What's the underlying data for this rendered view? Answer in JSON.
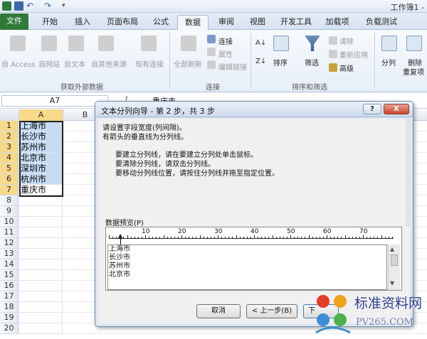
{
  "window": {
    "title": "工作簿1 -"
  },
  "tabs": {
    "file": "文件",
    "home": "开始",
    "insert": "插入",
    "layout": "页面布局",
    "formulas": "公式",
    "data": "数据",
    "review": "审阅",
    "view": "视图",
    "developer": "开发工具",
    "addins": "加载项",
    "loadtest": "负载测试"
  },
  "ribbon": {
    "from_access": "自 Access",
    "from_web": "自网站",
    "from_text": "自文本",
    "from_other": "自其他来源",
    "existing_conn": "现有连接",
    "refresh_all": "全部刷新",
    "connections": "连接",
    "properties": "属性",
    "edit_links": "编辑链接",
    "sort": "排序",
    "filter": "筛选",
    "clear": "清除",
    "reapply": "重新应用",
    "advanced": "高级",
    "text_to_columns": "分列",
    "remove_dup_1": "删除",
    "remove_dup_2": "重复项",
    "group_external": "获取外部数据",
    "group_conn": "连接",
    "group_sort": "排序和筛选"
  },
  "namebox": {
    "value": "A7"
  },
  "formula": {
    "value": "重庆市"
  },
  "columns": [
    "A",
    "B"
  ],
  "rows": [
    {
      "n": "1",
      "a": "上海市"
    },
    {
      "n": "2",
      "a": "长沙市"
    },
    {
      "n": "3",
      "a": "苏州市"
    },
    {
      "n": "4",
      "a": "北京市"
    },
    {
      "n": "5",
      "a": "深圳市"
    },
    {
      "n": "6",
      "a": "杭州市"
    },
    {
      "n": "7",
      "a": "重庆市"
    },
    {
      "n": "8",
      "a": ""
    },
    {
      "n": "9",
      "a": ""
    },
    {
      "n": "10",
      "a": ""
    },
    {
      "n": "11",
      "a": ""
    },
    {
      "n": "12",
      "a": ""
    },
    {
      "n": "13",
      "a": ""
    },
    {
      "n": "14",
      "a": ""
    },
    {
      "n": "15",
      "a": ""
    },
    {
      "n": "16",
      "a": ""
    },
    {
      "n": "17",
      "a": ""
    },
    {
      "n": "18",
      "a": ""
    },
    {
      "n": "19",
      "a": ""
    },
    {
      "n": "20",
      "a": ""
    }
  ],
  "dialog": {
    "title": "文本分列向导 - 第 2 步，共 3 步",
    "help": "?",
    "close": "X",
    "line1": "请设置字段宽度(列间隔)。",
    "line2": "有箭头的垂直线为分列线。",
    "tip1": "要建立分列线，请在要建立分列处单击鼠标。",
    "tip2": "要清除分列线，请双击分列线。",
    "tip3": "要移动分列线位置，请按住分列线并拖至指定位置。",
    "preview_label": "数据预览(P)",
    "ruler": [
      "10",
      "20",
      "30",
      "40",
      "50",
      "60",
      "70"
    ],
    "preview": [
      "上海市",
      "长沙市",
      "苏州市",
      "北京市"
    ],
    "cancel": "取消",
    "back": "< 上一步(B)",
    "next": "下"
  },
  "watermark": {
    "text": "标准资料网",
    "url": "PV265.COM"
  }
}
